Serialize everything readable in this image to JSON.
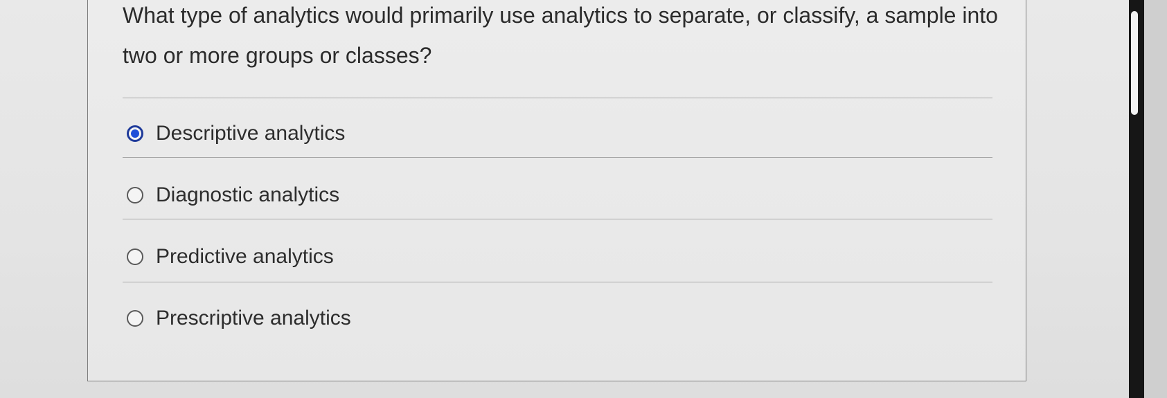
{
  "question": {
    "text": "What type of analytics would primarily use analytics to separate, or classify, a sample into two or more groups or classes?"
  },
  "options": [
    {
      "label": "Descriptive analytics",
      "selected": true
    },
    {
      "label": "Diagnostic analytics",
      "selected": false
    },
    {
      "label": "Predictive analytics",
      "selected": false
    },
    {
      "label": "Prescriptive analytics",
      "selected": false
    }
  ],
  "colors": {
    "selected_radio": "#1f4fd8",
    "text": "#2d2d2d",
    "scrollbar_track": "#161616",
    "scrollbar_thumb": "#f2f2f2"
  }
}
